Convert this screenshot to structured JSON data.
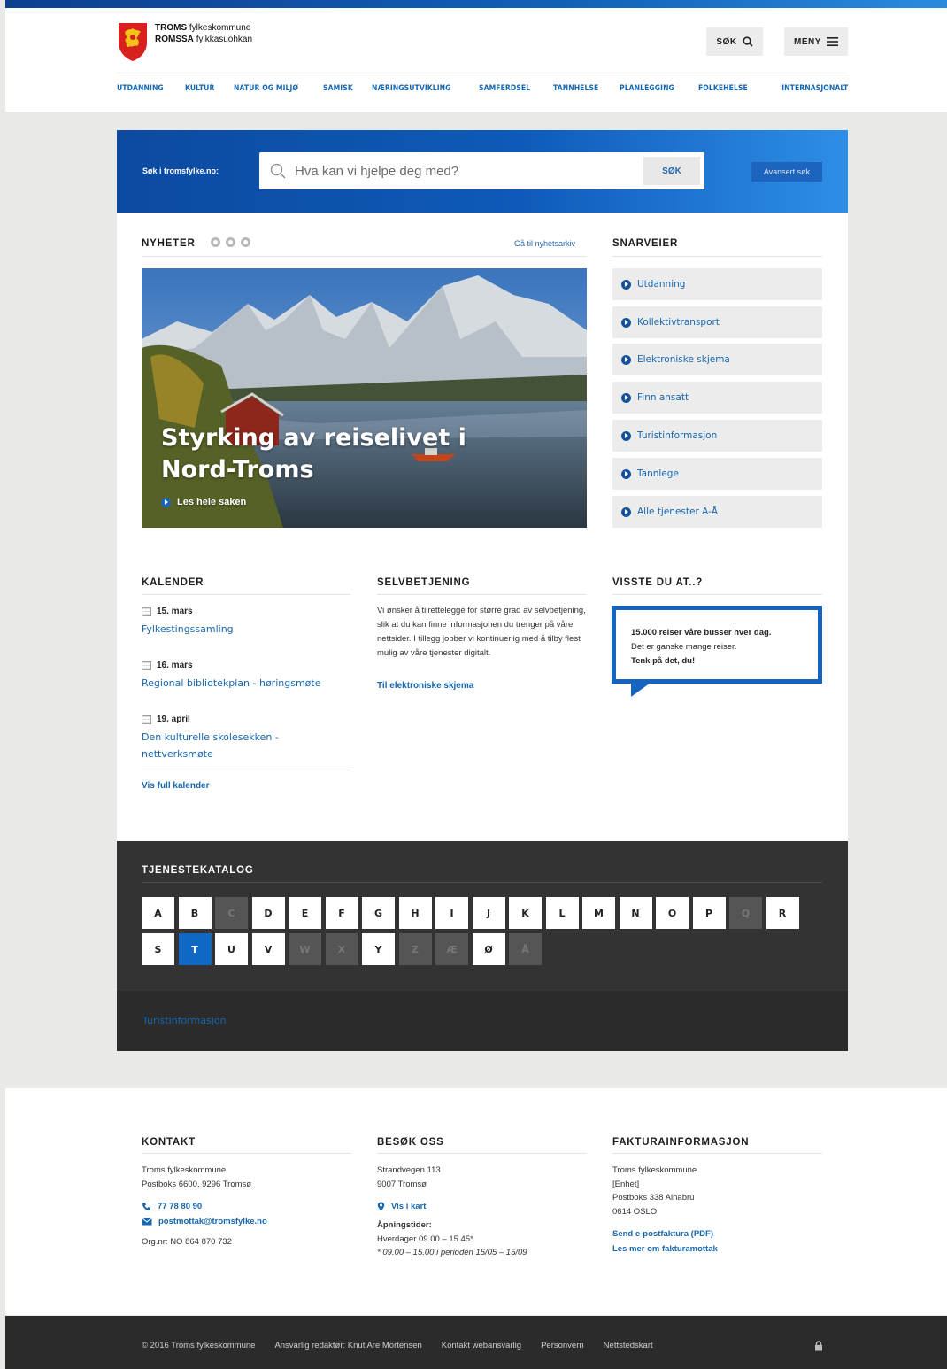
{
  "header": {
    "logo_line1_bold": "TROMS",
    "logo_line1_rest": "fylkeskommune",
    "logo_line2_bold": "ROMSSA",
    "logo_line2_rest": "fylkkasuohkan",
    "search_button": "SØK",
    "menu_button": "MENY",
    "nav": [
      "UTDANNING",
      "KULTUR",
      "NATUR OG MILJØ",
      "SAMISK",
      "NÆRINGSUTVIKLING",
      "SAMFERDSEL",
      "TANNHELSE",
      "PLANLEGGING",
      "FOLKEHELSE",
      "INTERNASJONALT"
    ]
  },
  "search": {
    "label": "Søk i tromsfylke.no:",
    "placeholder": "Hva kan vi hjelpe deg med?",
    "submit": "SØK",
    "advanced": "Avansert søk"
  },
  "news": {
    "title": "NYHETER",
    "archive_link": "Gå til nyhetsarkiv",
    "hero_title": "Styrking av reiselivet i Nord-Troms",
    "hero_link": "Les hele saken"
  },
  "shortcuts": {
    "title": "SNARVEIER",
    "items": [
      "Utdanning",
      "Kollektivtransport",
      "Elektroniske skjema",
      "Finn ansatt",
      "Turistinformasjon",
      "Tannlege",
      "Alle tjenester A-Å"
    ]
  },
  "calendar": {
    "title": "KALENDER",
    "events": [
      {
        "date": "15. mars",
        "title": "Fylkestingssamling"
      },
      {
        "date": "16. mars",
        "title": "Regional bibliotekplan - høringsmøte"
      },
      {
        "date": "19. april",
        "title": "Den kulturelle skolesekken - nettverksmøte"
      }
    ],
    "full_link": "Vis full kalender"
  },
  "selfservice": {
    "title": "SELVBETJENING",
    "text": "Vi ønsker å tilrettelegge for større grad av selvbetjening, slik at du kan finne informasjonen du trenger på våre nettsider. I tillegg jobber vi kontinuerlig med å tilby flest mulig av våre tjenester digitalt.",
    "link": "Til elektroniske skjema"
  },
  "didyouknow": {
    "title": "VISSTE DU AT..?",
    "line1": "15.000 reiser våre busser hver dag.",
    "line2": "Det er ganske mange reiser.",
    "line3": "Tenk på det, du!"
  },
  "catalog": {
    "title": "TJENESTEKATALOG",
    "letters": [
      {
        "l": "A",
        "s": "on"
      },
      {
        "l": "B",
        "s": "on"
      },
      {
        "l": "C",
        "s": "off"
      },
      {
        "l": "D",
        "s": "on"
      },
      {
        "l": "E",
        "s": "on"
      },
      {
        "l": "F",
        "s": "on"
      },
      {
        "l": "G",
        "s": "on"
      },
      {
        "l": "H",
        "s": "on"
      },
      {
        "l": "I",
        "s": "on"
      },
      {
        "l": "J",
        "s": "on"
      },
      {
        "l": "K",
        "s": "on"
      },
      {
        "l": "L",
        "s": "on"
      },
      {
        "l": "M",
        "s": "on"
      },
      {
        "l": "N",
        "s": "on"
      },
      {
        "l": "O",
        "s": "on"
      },
      {
        "l": "P",
        "s": "on"
      },
      {
        "l": "Q",
        "s": "off"
      },
      {
        "l": "R",
        "s": "on"
      },
      {
        "l": "S",
        "s": "on"
      },
      {
        "l": "T",
        "s": "active"
      },
      {
        "l": "U",
        "s": "on"
      },
      {
        "l": "V",
        "s": "on"
      },
      {
        "l": "W",
        "s": "off"
      },
      {
        "l": "X",
        "s": "off"
      },
      {
        "l": "Y",
        "s": "on"
      },
      {
        "l": "Z",
        "s": "off"
      },
      {
        "l": "Æ",
        "s": "off"
      },
      {
        "l": "Ø",
        "s": "on"
      },
      {
        "l": "Å",
        "s": "off"
      }
    ],
    "result": "Turistinformasjon"
  },
  "footer": {
    "contact": {
      "title": "KONTAKT",
      "line1": "Troms fylkeskommune",
      "line2": "Postboks 6600, 9296 Tromsø",
      "phone": "77 78 80 90",
      "email": "postmottak@tromsfylke.no",
      "orgnr": "Org.nr: NO 864 870 732"
    },
    "visit": {
      "title": "BESØK OSS",
      "line1": "Strandvegen 113",
      "line2": "9007 Tromsø",
      "map_link": "Vis i kart",
      "hours_title": "Åpningstider:",
      "hours": "Hverdager 09.00 – 15.45*",
      "hours_note": "* 09.00 – 15.00 i perioden 15/05 – 15/09"
    },
    "invoice": {
      "title": "FAKTURAINFORMASJON",
      "line1": "Troms fylkeskommune",
      "line2": "[Enhet]",
      "line3": "Postboks 338 Alnabru",
      "line4": "0614 OSLO",
      "link1": "Send e-postfaktura (PDF)",
      "link2": "Les mer om fakturamottak"
    }
  },
  "bottom_bar": {
    "copyright": "© 2016 Troms fylkeskommune",
    "editor": "Ansvarlig redaktør: Knut Are Mortensen",
    "webmaster": "Kontakt webansvarlig",
    "privacy": "Personvern",
    "sitemap": "Nettstedskart"
  }
}
